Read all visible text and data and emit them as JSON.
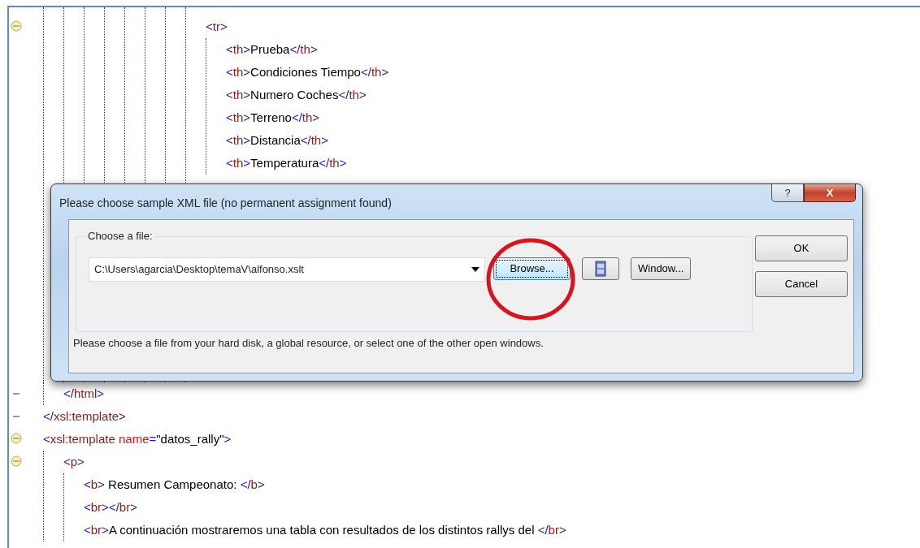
{
  "editor": {
    "top_lines": [
      {
        "fold_marker": true,
        "line": [
          {
            "kind": "punct",
            "text": "<"
          },
          {
            "kind": "name",
            "text": "tr"
          },
          {
            "kind": "punct",
            "text": ">"
          }
        ],
        "children": [
          {
            "line": [
              {
                "kind": "punct",
                "text": "<"
              },
              {
                "kind": "name",
                "text": "th"
              },
              {
                "kind": "punct",
                "text": ">"
              },
              {
                "kind": "text",
                "text": "Prueba"
              },
              {
                "kind": "punct",
                "text": "</"
              },
              {
                "kind": "name",
                "text": "th"
              },
              {
                "kind": "punct",
                "text": ">"
              }
            ]
          },
          {
            "line": [
              {
                "kind": "punct",
                "text": "<"
              },
              {
                "kind": "name",
                "text": "th"
              },
              {
                "kind": "punct",
                "text": ">"
              },
              {
                "kind": "text",
                "text": "Condiciones Tiempo"
              },
              {
                "kind": "punct",
                "text": "</"
              },
              {
                "kind": "name",
                "text": "th"
              },
              {
                "kind": "punct",
                "text": ">"
              }
            ]
          },
          {
            "line": [
              {
                "kind": "punct",
                "text": "<"
              },
              {
                "kind": "name",
                "text": "th"
              },
              {
                "kind": "punct",
                "text": ">"
              },
              {
                "kind": "text",
                "text": "Numero Coches"
              },
              {
                "kind": "punct",
                "text": "</"
              },
              {
                "kind": "name",
                "text": "th"
              },
              {
                "kind": "punct",
                "text": ">"
              }
            ]
          },
          {
            "line": [
              {
                "kind": "punct",
                "text": "<"
              },
              {
                "kind": "name",
                "text": "th"
              },
              {
                "kind": "punct",
                "text": ">"
              },
              {
                "kind": "text",
                "text": "Terreno"
              },
              {
                "kind": "punct",
                "text": "</"
              },
              {
                "kind": "name",
                "text": "th"
              },
              {
                "kind": "punct",
                "text": ">"
              }
            ]
          },
          {
            "line": [
              {
                "kind": "punct",
                "text": "<"
              },
              {
                "kind": "name",
                "text": "th"
              },
              {
                "kind": "punct",
                "text": ">"
              },
              {
                "kind": "text",
                "text": "Distancia"
              },
              {
                "kind": "punct",
                "text": "</"
              },
              {
                "kind": "name",
                "text": "th"
              },
              {
                "kind": "punct",
                "text": ">"
              }
            ]
          },
          {
            "line": [
              {
                "kind": "punct",
                "text": "<"
              },
              {
                "kind": "name",
                "text": "th"
              },
              {
                "kind": "punct",
                "text": ">"
              },
              {
                "kind": "text",
                "text": "Temperatura"
              },
              {
                "kind": "punct",
                "text": "</"
              },
              {
                "kind": "name",
                "text": "th"
              },
              {
                "kind": "punct",
                "text": ">"
              }
            ]
          }
        ]
      }
    ],
    "bottom_lines": [
      {
        "children": [
          {
            "fold_end": true,
            "line": [
              {
                "kind": "punct",
                "text": "</"
              },
              {
                "kind": "name",
                "text": "html"
              },
              {
                "kind": "punct",
                "text": ">"
              }
            ]
          }
        ]
      },
      {
        "fold_end": true,
        "line": [
          {
            "kind": "punct",
            "text": "</"
          },
          {
            "kind": "name",
            "text": "xsl:template"
          },
          {
            "kind": "punct",
            "text": ">"
          }
        ]
      },
      {
        "fold_marker": true,
        "line": [
          {
            "kind": "punct",
            "text": "<"
          },
          {
            "kind": "name",
            "text": "xsl:template"
          },
          {
            "kind": "attr",
            "text": " name"
          },
          {
            "kind": "punct",
            "text": "="
          },
          {
            "kind": "text",
            "text": "\"datos_rally\""
          },
          {
            "kind": "punct",
            "text": ">"
          }
        ],
        "children": [
          {
            "fold_marker": true,
            "line": [
              {
                "kind": "punct",
                "text": "<"
              },
              {
                "kind": "name",
                "text": "p"
              },
              {
                "kind": "punct",
                "text": ">"
              }
            ],
            "children": [
              {
                "line": [
                  {
                    "kind": "punct",
                    "text": "<"
                  },
                  {
                    "kind": "name",
                    "text": "b"
                  },
                  {
                    "kind": "punct",
                    "text": ">"
                  },
                  {
                    "kind": "text",
                    "text": " Resumen Campeonato: "
                  },
                  {
                    "kind": "punct",
                    "text": "</"
                  },
                  {
                    "kind": "name",
                    "text": "b"
                  },
                  {
                    "kind": "punct",
                    "text": ">"
                  }
                ]
              },
              {
                "line": [
                  {
                    "kind": "punct",
                    "text": "<"
                  },
                  {
                    "kind": "name",
                    "text": "br"
                  },
                  {
                    "kind": "punct",
                    "text": "></"
                  },
                  {
                    "kind": "name",
                    "text": "br"
                  },
                  {
                    "kind": "punct",
                    "text": ">"
                  }
                ]
              },
              {
                "line": [
                  {
                    "kind": "punct",
                    "text": "<"
                  },
                  {
                    "kind": "name",
                    "text": "br"
                  },
                  {
                    "kind": "punct",
                    "text": ">"
                  },
                  {
                    "kind": "text",
                    "text": "A continuación mostraremos una tabla con resultados de los distintos rallys del "
                  },
                  {
                    "kind": "punct",
                    "text": "</"
                  },
                  {
                    "kind": "name",
                    "text": "br"
                  },
                  {
                    "kind": "punct",
                    "text": ">"
                  }
                ]
              }
            ]
          }
        ]
      }
    ]
  },
  "dialog": {
    "title": "Please choose sample XML file (no permanent assignment found)",
    "help_button": "?",
    "close_button": "X",
    "group_label": "Choose a file:",
    "file_value": "C:\\Users\\agarcia\\Desktop\\temaV\\alfonso.xslt",
    "buttons": [
      {
        "kind": "text",
        "label": "Browse...",
        "focused": true,
        "circled": true
      },
      {
        "kind": "icon"
      },
      {
        "kind": "text",
        "label": "Window...",
        "focused": false,
        "circled": false
      }
    ],
    "ok_button": "OK",
    "cancel_button": "Cancel",
    "hint": "Please choose a file from your hard disk, a global resource, or select one of the other open windows."
  }
}
